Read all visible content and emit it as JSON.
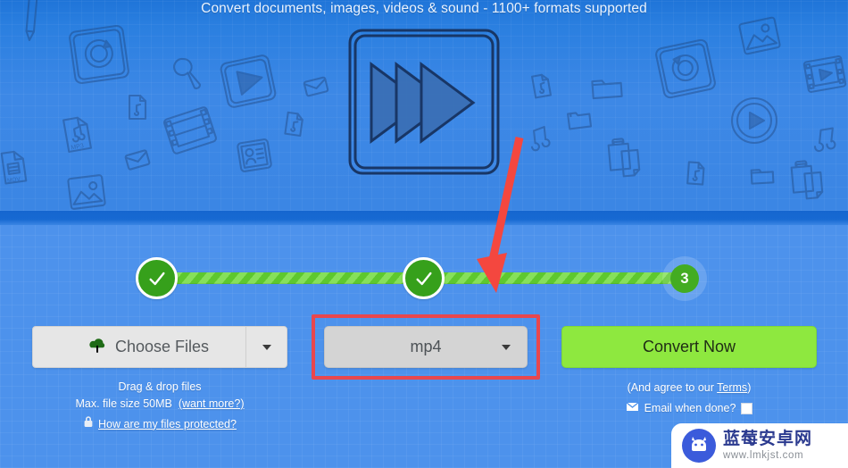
{
  "banner": {
    "tagline": "Convert documents, images, videos & sound - 1100+ formats supported",
    "hero_icon": "fast-forward-sketch-icon"
  },
  "stepper": {
    "step1": {
      "state": "done",
      "icon": "check-icon"
    },
    "step2": {
      "state": "done",
      "icon": "check-icon"
    },
    "step3": {
      "state": "current",
      "label": "3"
    }
  },
  "annotations": {
    "arrow_color": "#f4473f",
    "highlight_box_color": "#e8474e"
  },
  "controls": {
    "choose": {
      "button_label": "Choose Files",
      "upload_icon": "cloud-upload-icon",
      "caret_icon": "chevron-down-icon",
      "drag_drop_text": "Drag & drop files",
      "max_size_text": "Max. file size 50MB",
      "want_more_link": "(want more?)",
      "lock_icon": "lock-icon",
      "protected_link": "How are my files protected?"
    },
    "format": {
      "value": "mp4",
      "caret_icon": "chevron-down-icon"
    },
    "convert": {
      "button_label": "Convert Now",
      "terms_prefix": "(And agree to our ",
      "terms_link": "Terms",
      "terms_suffix": ")",
      "mail_icon": "envelope-icon",
      "email_label": "Email when done?",
      "checkbox_checked": false
    }
  },
  "watermark": {
    "logo_icon": "blueberry-android-logo-icon",
    "site_name": "蓝莓安卓网",
    "url": "www.lmkjst.com"
  },
  "colors": {
    "banner_blue": "#3b86e4",
    "panel_blue": "#4d92ec",
    "progress_green": "#5ec82f",
    "step_done_green": "#36a01b",
    "convert_green": "#8ee83f",
    "accent_red": "#e8474e"
  }
}
